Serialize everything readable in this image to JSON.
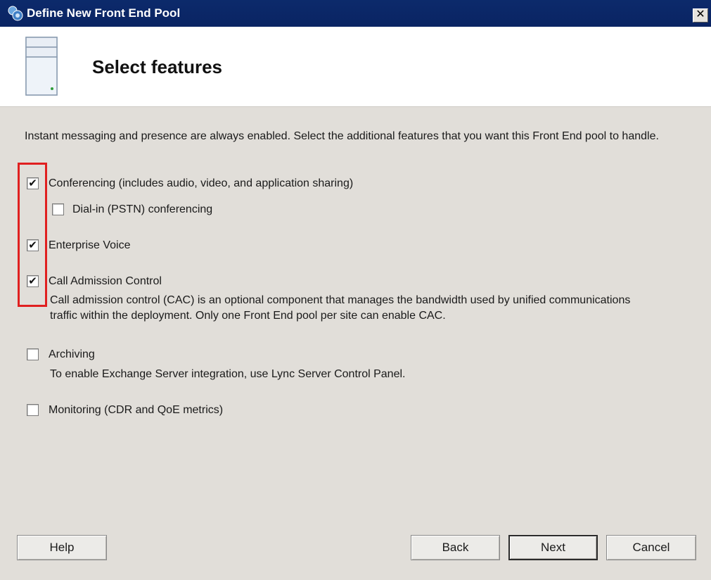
{
  "window": {
    "title": "Define New Front End Pool",
    "close_label": "✕"
  },
  "header": {
    "title": "Select features",
    "icon": "server-icon"
  },
  "intro_text": "Instant messaging and presence are always enabled.  Select the additional features that you want this Front End pool to handle.",
  "features": {
    "conferencing": {
      "label": "Conferencing (includes audio, video, and application sharing)",
      "checked": true
    },
    "dial_in": {
      "label": "Dial-in (PSTN) conferencing",
      "checked": false
    },
    "enterprise_voice": {
      "label": "Enterprise Voice",
      "checked": true
    },
    "cac": {
      "label": "Call Admission Control",
      "checked": true,
      "description": "Call admission control (CAC) is an optional component that manages the bandwidth used by unified communications traffic within the deployment. Only one Front End pool per site can enable CAC."
    },
    "archiving": {
      "label": "Archiving",
      "checked": false,
      "description": "To enable Exchange Server integration, use Lync Server Control Panel."
    },
    "monitoring": {
      "label": "Monitoring (CDR and QoE metrics)",
      "checked": false
    }
  },
  "buttons": {
    "help": "Help",
    "back": "Back",
    "next": "Next",
    "cancel": "Cancel"
  },
  "colors": {
    "titlebar": "#0a2463",
    "highlight": "#e02020",
    "background": "#e1ded9"
  }
}
